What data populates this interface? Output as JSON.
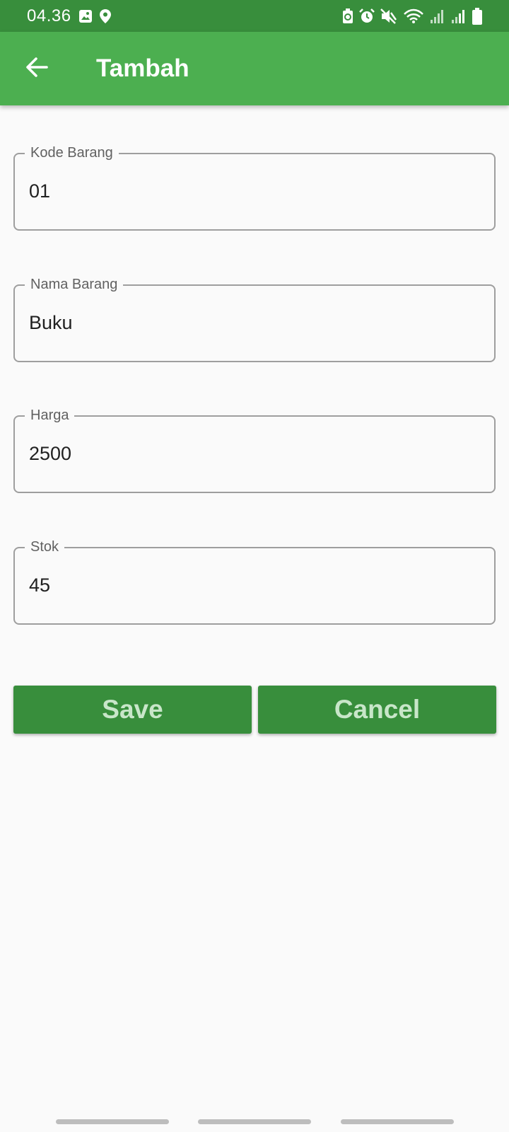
{
  "status_bar": {
    "time": "04.36",
    "icons": [
      "image-icon",
      "location-icon",
      "battery-saver-icon",
      "alarm-icon",
      "mute-icon",
      "wifi-icon",
      "signal-icon",
      "signal-icon-2",
      "battery-icon"
    ]
  },
  "app_bar": {
    "title": "Tambah",
    "back_icon": "arrow-back-icon"
  },
  "form": {
    "fields": [
      {
        "label": "Kode Barang",
        "value": "01"
      },
      {
        "label": "Nama Barang",
        "value": "Buku"
      },
      {
        "label": "Harga",
        "value": "2500"
      },
      {
        "label": "Stok",
        "value": "45"
      }
    ]
  },
  "buttons": {
    "save_label": "Save",
    "cancel_label": "Cancel"
  },
  "colors": {
    "status_bar": "#388e3c",
    "app_bar": "#4caf50",
    "button_bg": "#388e3c",
    "button_text": "#c8e6c9",
    "field_border": "#9e9e9e",
    "background": "#fafafa"
  }
}
